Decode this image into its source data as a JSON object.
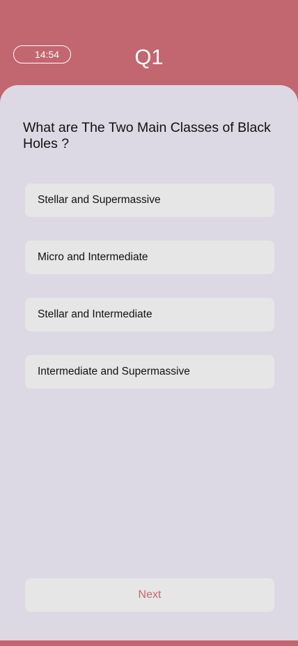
{
  "header": {
    "timer": "14:54",
    "question_number": "Q1"
  },
  "question": {
    "text": "What are The Two Main Classes of Black Holes ?"
  },
  "options": [
    {
      "label": "Stellar and Supermassive"
    },
    {
      "label": "Micro and Intermediate"
    },
    {
      "label": "Stellar and Intermediate"
    },
    {
      "label": "Intermediate and Supermassive"
    }
  ],
  "actions": {
    "next_label": "Next"
  },
  "colors": {
    "accent": "#c26670",
    "panel_background": "#dcd9e4",
    "option_background": "#e6e6e6"
  }
}
